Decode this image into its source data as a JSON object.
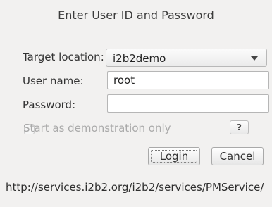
{
  "dialog": {
    "title": "Enter User ID and Password",
    "target_label": "Target location:",
    "target_value": "i2b2demo",
    "user_label": "User name:",
    "user_value": "root",
    "password_label": "Password:",
    "password_value": "",
    "demo_label": "Start as demonstration only",
    "help_label": "?",
    "login_label": "Login",
    "cancel_label": "Cancel",
    "service_url": "http://services.i2b2.org/i2b2/services/PMService/"
  }
}
